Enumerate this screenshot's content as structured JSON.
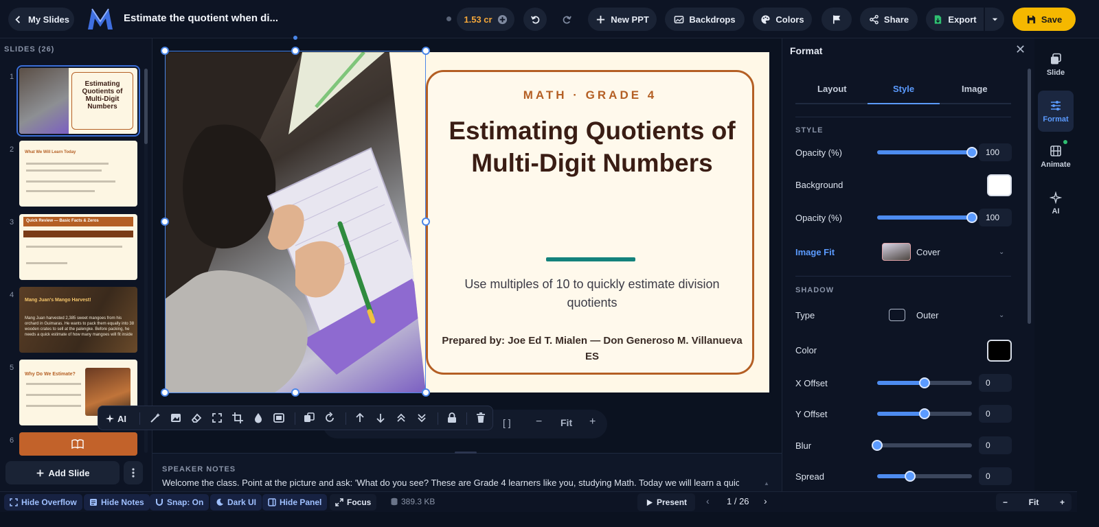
{
  "topbar": {
    "back_label": "My Slides",
    "doc_title": "Estimate the quotient when di...",
    "credits": "1.53 cr",
    "new_ppt": "New PPT",
    "backdrops": "Backdrops",
    "colors": "Colors",
    "share": "Share",
    "export": "Export",
    "save": "Save"
  },
  "sidebar": {
    "slides_label": "SLIDES (26)",
    "add_slide": "Add Slide",
    "thumbs": [
      {
        "num": "1",
        "heading": "Estimating Quotients of Multi-Digit Numbers"
      },
      {
        "num": "2",
        "heading": "What We Will Learn Today"
      },
      {
        "num": "3",
        "heading": "Quick Review — Basic Facts & Zeros"
      },
      {
        "num": "4",
        "heading": "Mang Juan's Mango Harvest!",
        "body": "Mang Juan harvested 2,385 sweet mangoes from his orchard in Guimaras. He wants to pack them equally into 38 wooden crates to sell at the palengke. Before packing, he needs a quick estimate of how many mangoes will fit inside"
      },
      {
        "num": "5",
        "heading": "Why Do We Estimate?"
      },
      {
        "num": "6"
      }
    ]
  },
  "slide": {
    "eyebrow": "MATH · GRADE 4",
    "title": "Estimating Quotients of Multi-Digit Numbers",
    "subtitle": "Use multiples of 10 to quickly estimate division quotients",
    "prepared": "Prepared by: Joe Ed T. Mialen — Don Generoso M. Villanueva ES"
  },
  "toolbar": {
    "ai": "AI",
    "zoom_fit": "Fit"
  },
  "notes": {
    "label": "SPEAKER NOTES",
    "text": "Welcome the class. Point at the picture and ask: 'What do you see? These are Grade 4 learners like you, studying Math. Today we will learn a quick way to"
  },
  "format_panel": {
    "title": "Format",
    "tabs": [
      "Layout",
      "Style",
      "Image"
    ],
    "style_header": "STYLE",
    "opacity_label": "Opacity (%)",
    "opacity_value": "100",
    "opacity_level": 1.0,
    "background_label": "Background",
    "background_color": "#ffffff",
    "opacity2_label": "Opacity (%)",
    "opacity2_value": "100",
    "opacity2_level": 1.0,
    "image_fit_label": "Image Fit",
    "image_fit_value": "Cover",
    "shadow_header": "SHADOW",
    "type_label": "Type",
    "type_value": "Outer",
    "color_label": "Color",
    "shadow_color": "#000000",
    "x_offset_label": "X Offset",
    "x_offset_value": "0",
    "x_offset_level": 0.5,
    "y_offset_label": "Y Offset",
    "y_offset_value": "0",
    "y_offset_level": 0.5,
    "blur_label": "Blur",
    "blur_value": "0",
    "blur_level": 0.0,
    "spread_label": "Spread",
    "spread_value": "0",
    "spread_level": 0.35
  },
  "rail": {
    "slide": "Slide",
    "format": "Format",
    "animate": "Animate",
    "ai": "AI"
  },
  "statusbar": {
    "hide_overflow": "Hide Overflow",
    "hide_notes": "Hide Notes",
    "snap": "Snap: On",
    "dark_ui": "Dark UI",
    "hide_panel": "Hide Panel",
    "focus": "Focus",
    "size": "389.3 KB",
    "present": "Present",
    "page": "1 / 26",
    "zoom": "Fit"
  },
  "colors": {
    "accent": "#5b9bff",
    "save": "#f5b800",
    "slide_brown": "#b45f24",
    "slide_teal": "#14827c"
  }
}
